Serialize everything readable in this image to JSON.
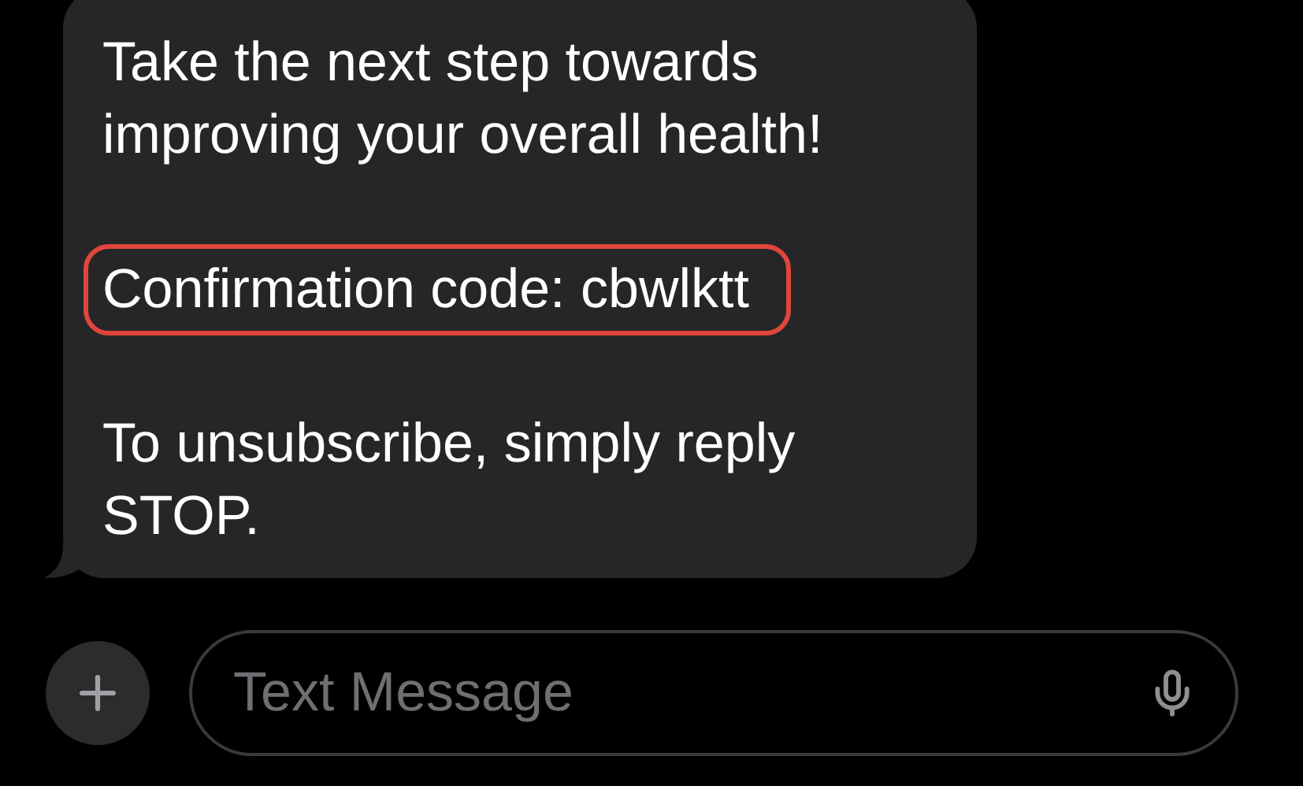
{
  "message": {
    "paragraphs": [
      {
        "text": "Take the next step towards improving your overall health!",
        "highlighted": false
      },
      {
        "text": "Confirmation code: cbwlktt",
        "highlighted": true
      },
      {
        "text": "To unsubscribe, simply reply STOP.",
        "highlighted": false
      }
    ]
  },
  "composer": {
    "placeholder": "Text Message"
  }
}
